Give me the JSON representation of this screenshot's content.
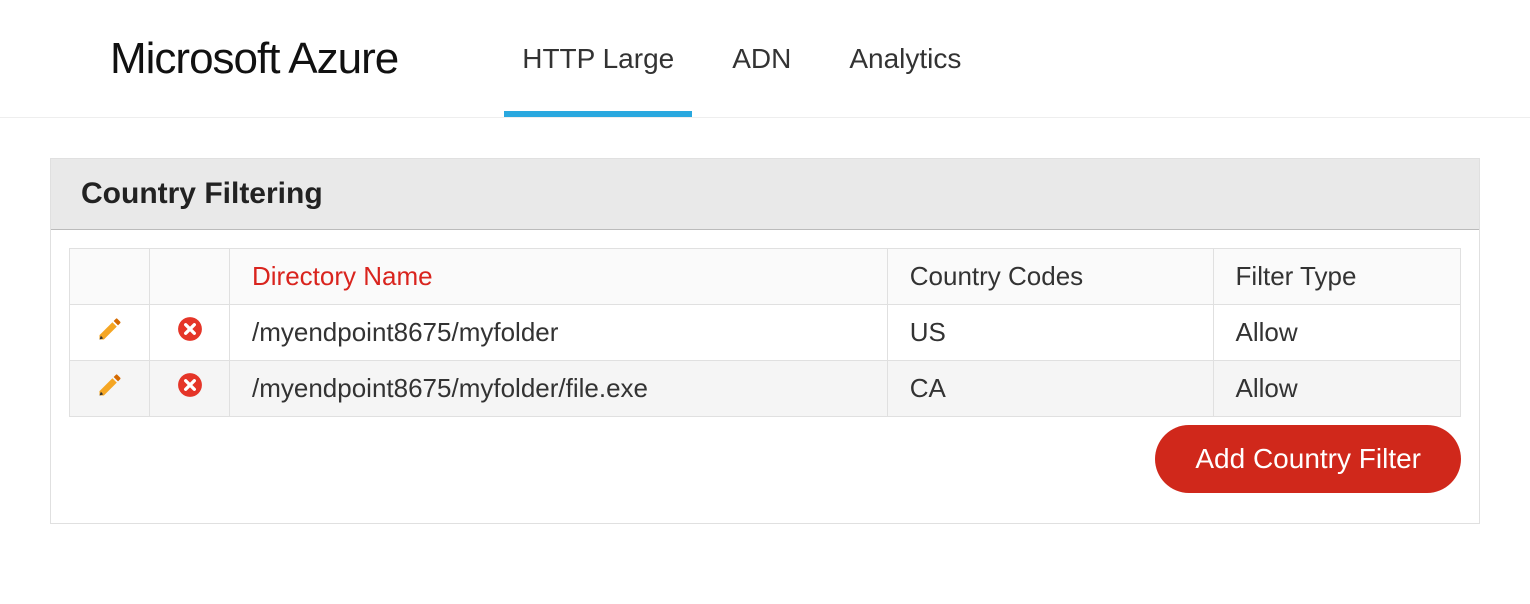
{
  "header": {
    "logo_text": "Microsoft Azure",
    "tabs": [
      {
        "label": "HTTP Large",
        "active": true
      },
      {
        "label": "ADN",
        "active": false
      },
      {
        "label": "Analytics",
        "active": false
      }
    ]
  },
  "panel": {
    "title": "Country Filtering",
    "columns": {
      "edit": "",
      "delete": "",
      "directory": "Directory Name",
      "codes": "Country Codes",
      "filter": "Filter Type"
    },
    "rows": [
      {
        "directory": "/myendpoint8675/myfolder",
        "codes": "US",
        "filter": "Allow"
      },
      {
        "directory": "/myendpoint8675/myfolder/file.exe",
        "codes": "CA",
        "filter": "Allow"
      }
    ],
    "add_button_label": "Add Country Filter"
  },
  "icons": {
    "edit": "pencil-icon",
    "delete": "delete-icon"
  }
}
